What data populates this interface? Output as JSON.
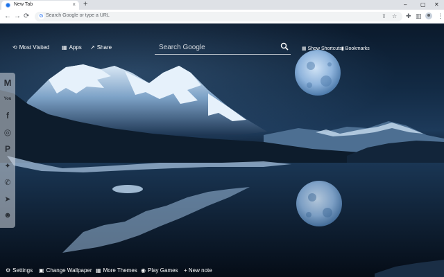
{
  "browser": {
    "tab_title": "New Tab",
    "tab_close": "×",
    "new_tab": "+",
    "window_controls": {
      "minimize": "–",
      "maximize": "▢",
      "close": "✕"
    },
    "omnibox_placeholder": "Search Google or type a URL",
    "nav": {
      "back": "←",
      "forward": "→",
      "reload": "⟳"
    },
    "toolbar_icons": {
      "share": "⇪",
      "bookmark_star": "☆",
      "extensions": "✚",
      "sidebar": "▥",
      "menu": "⋮"
    }
  },
  "newtab": {
    "most_visited": "Most Visited",
    "apps": "Apps",
    "share": "Share",
    "search_placeholder": "Search Google",
    "show_shortcuts": "Show Shortcuts",
    "bookmarks": "Bookmarks"
  },
  "social": [
    {
      "name": "gmail",
      "glyph": "M"
    },
    {
      "name": "youtube",
      "glyph": "You"
    },
    {
      "name": "facebook",
      "glyph": "f"
    },
    {
      "name": "instagram",
      "glyph": "◎"
    },
    {
      "name": "pinterest",
      "glyph": "P"
    },
    {
      "name": "twitter",
      "glyph": "✦"
    },
    {
      "name": "whatsapp",
      "glyph": "✆"
    },
    {
      "name": "telegram",
      "glyph": "➤"
    },
    {
      "name": "reddit",
      "glyph": "☻"
    }
  ],
  "bottom": {
    "settings": "Settings",
    "change_wallpaper": "Change Wallpaper",
    "more_themes": "More Themes",
    "play_games": "Play Games",
    "new_note": "+ New note"
  },
  "colors": {
    "moon": "#8fb4dc",
    "water": "#0a1626",
    "snow": "#c8ddf0"
  }
}
